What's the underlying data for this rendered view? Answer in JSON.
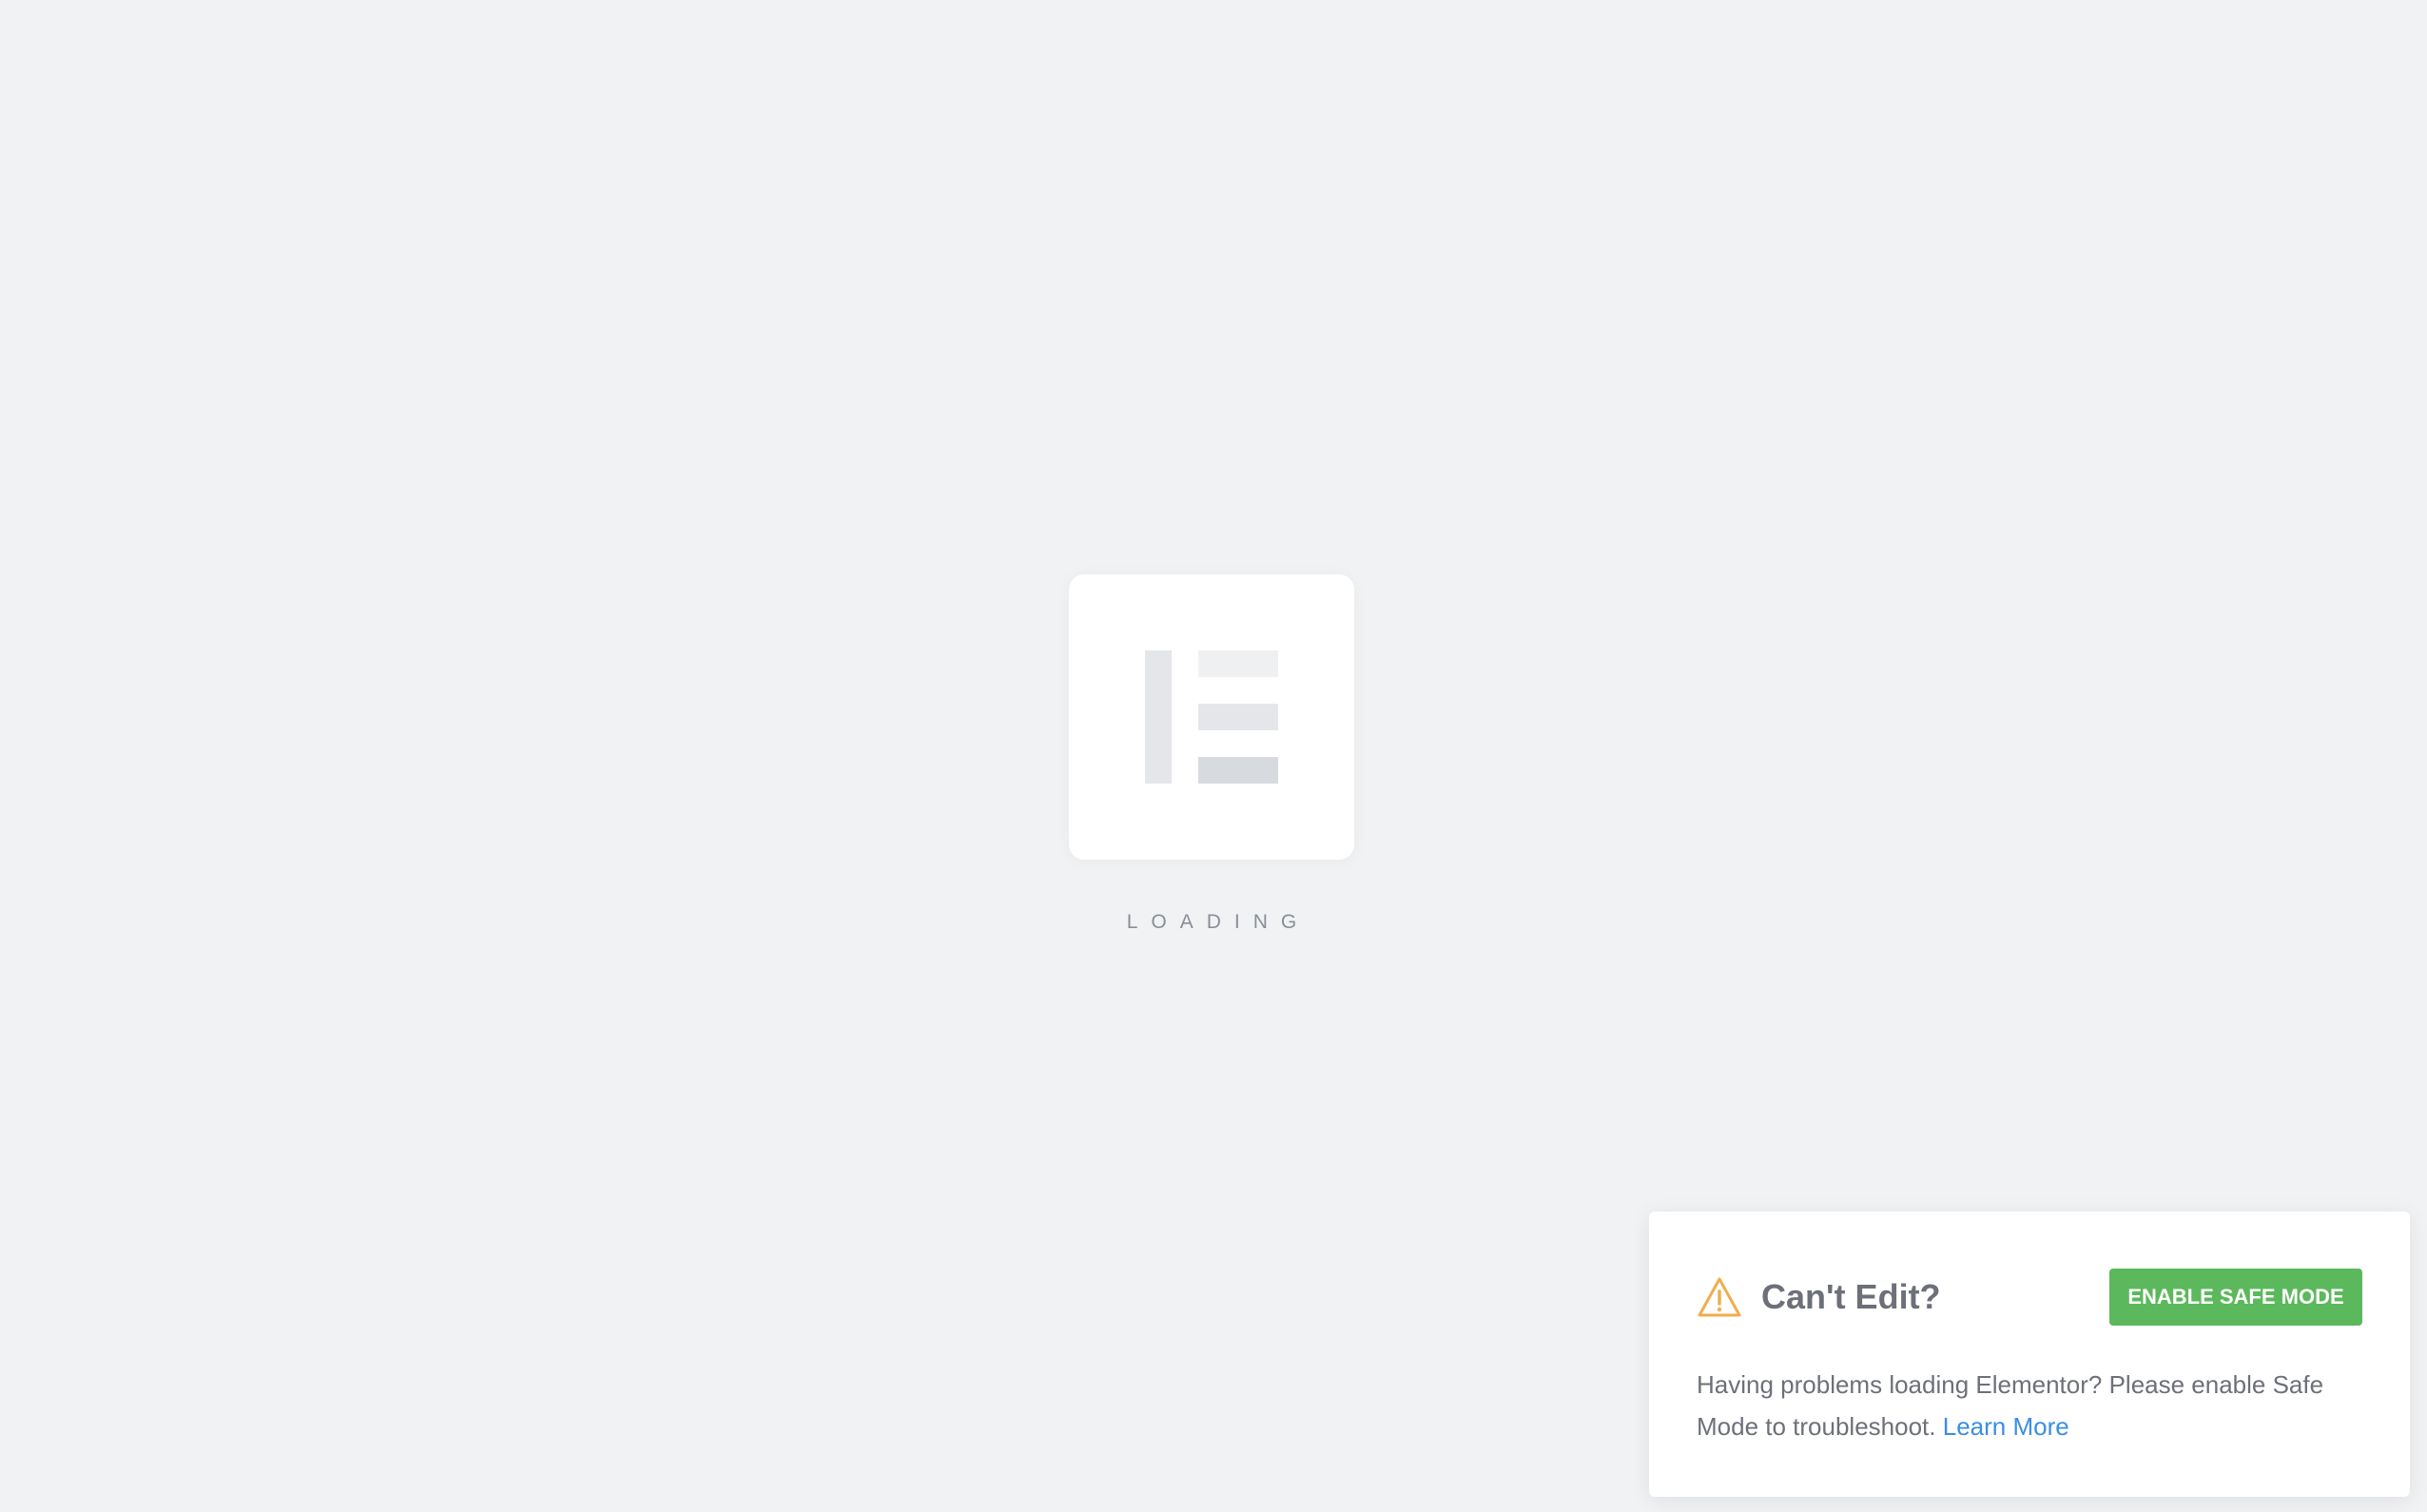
{
  "loader": {
    "text": "LOADING"
  },
  "notice": {
    "title": "Can't Edit?",
    "button_label": "ENABLE SAFE MODE",
    "message": "Having problems loading Elementor? Please enable Safe Mode to troubleshoot.",
    "link_label": "Learn More",
    "icon": "warning-icon"
  },
  "colors": {
    "background": "#f1f2f4",
    "button": "#5cb85c",
    "link": "#3a8ee6",
    "warning": "#f0ad4e",
    "text": "#6d7079"
  }
}
